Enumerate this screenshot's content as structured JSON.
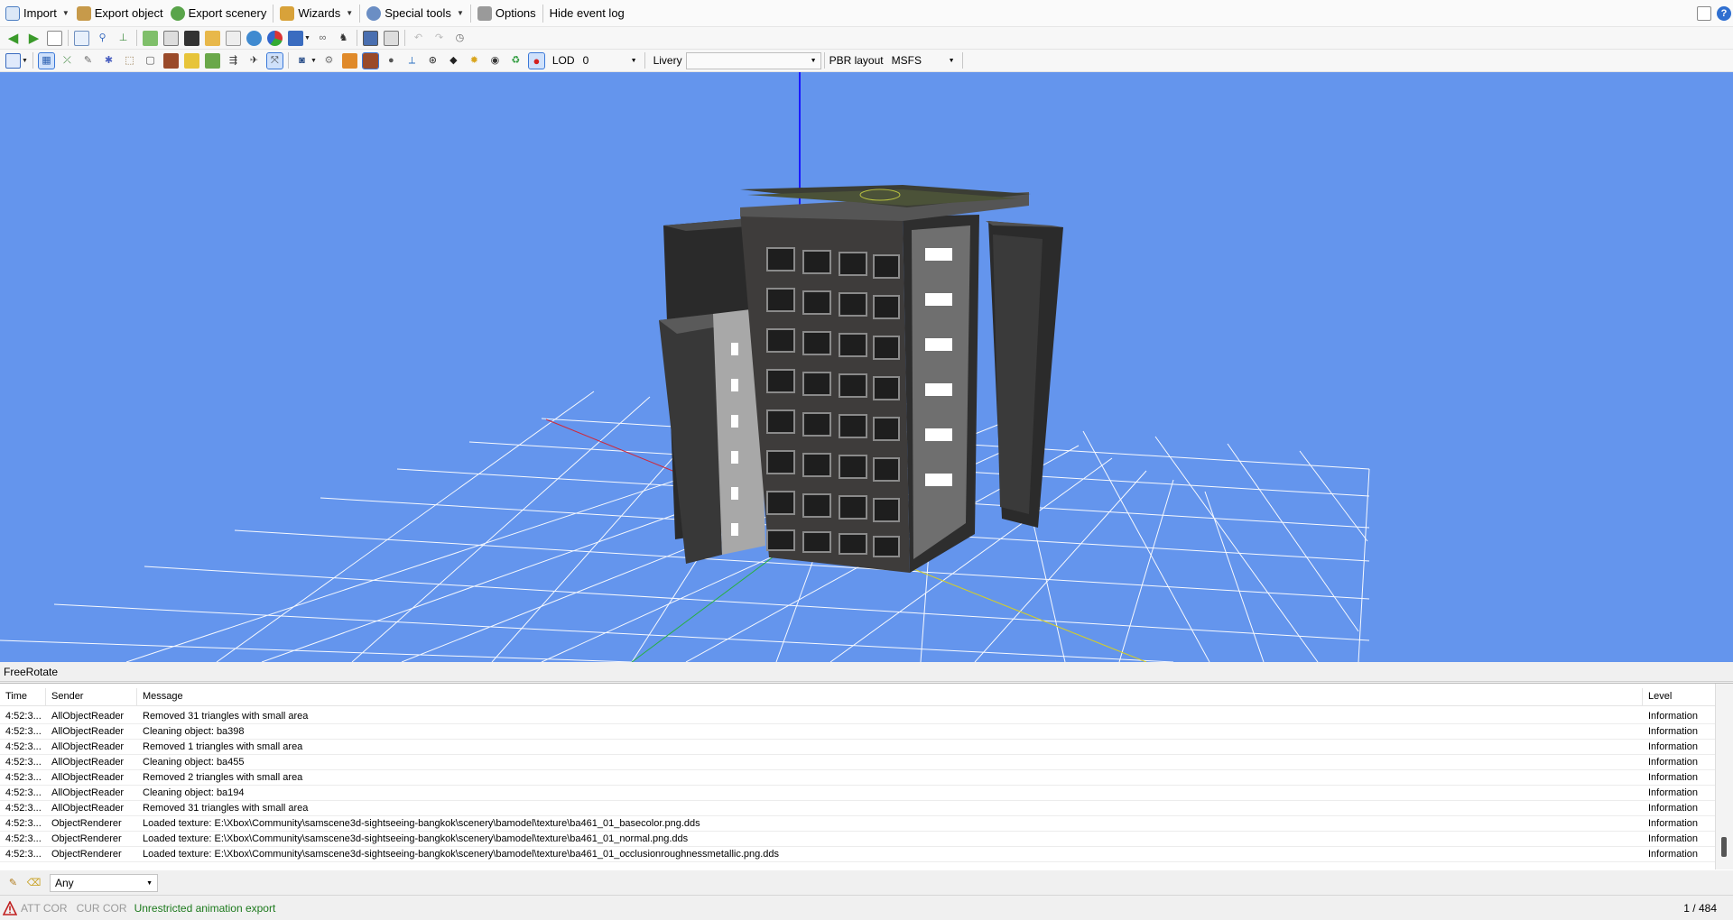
{
  "menubar": {
    "import": "Import",
    "export_object": "Export object",
    "export_scenery": "Export scenery",
    "wizards": "Wizards",
    "special_tools": "Special tools",
    "options": "Options",
    "hide_event_log": "Hide event log",
    "help": "?"
  },
  "toolbar2": {
    "lod_label": "LOD",
    "lod_value": "0",
    "livery_label": "Livery",
    "livery_value": "",
    "pbr_label": "PBR layout",
    "pbr_value": "MSFS"
  },
  "mode": "FreeRotate",
  "log": {
    "headers": {
      "time": "Time",
      "sender": "Sender",
      "message": "Message",
      "level": "Level"
    },
    "rows": [
      {
        "time": "4:52:3...",
        "sender": "AllObjectReader",
        "message": "Removed 31 triangles with small area",
        "level": "Information"
      },
      {
        "time": "4:52:3...",
        "sender": "AllObjectReader",
        "message": "Cleaning object: ba398",
        "level": "Information"
      },
      {
        "time": "4:52:3...",
        "sender": "AllObjectReader",
        "message": "Removed 1 triangles with small area",
        "level": "Information"
      },
      {
        "time": "4:52:3...",
        "sender": "AllObjectReader",
        "message": "Cleaning object: ba455",
        "level": "Information"
      },
      {
        "time": "4:52:3...",
        "sender": "AllObjectReader",
        "message": "Removed 2 triangles with small area",
        "level": "Information"
      },
      {
        "time": "4:52:3...",
        "sender": "AllObjectReader",
        "message": "Cleaning object: ba194",
        "level": "Information"
      },
      {
        "time": "4:52:3...",
        "sender": "AllObjectReader",
        "message": "Removed 31 triangles with small area",
        "level": "Information"
      },
      {
        "time": "4:52:3...",
        "sender": "ObjectRenderer",
        "message": "Loaded texture: E:\\Xbox\\Community\\samscene3d-sightseeing-bangkok\\scenery\\bamodel\\texture\\ba461_01_basecolor.png.dds",
        "level": "Information"
      },
      {
        "time": "4:52:3...",
        "sender": "ObjectRenderer",
        "message": "Loaded texture: E:\\Xbox\\Community\\samscene3d-sightseeing-bangkok\\scenery\\bamodel\\texture\\ba461_01_normal.png.dds",
        "level": "Information"
      },
      {
        "time": "4:52:3...",
        "sender": "ObjectRenderer",
        "message": "Loaded texture: E:\\Xbox\\Community\\samscene3d-sightseeing-bangkok\\scenery\\bamodel\\texture\\ba461_01_occlusionroughnessmetallic.png.dds",
        "level": "Information"
      }
    ]
  },
  "filter": {
    "value": "Any"
  },
  "footer": {
    "att_cor": "ATT COR",
    "cur_cor": "CUR COR",
    "animation": "Unrestricted animation export",
    "count": "1 / 484"
  },
  "colors": {
    "viewport_bg": "#6495ed",
    "grid": "#ffffff",
    "building": "#3e3c3b",
    "animation_text": "#1d7a1d"
  }
}
